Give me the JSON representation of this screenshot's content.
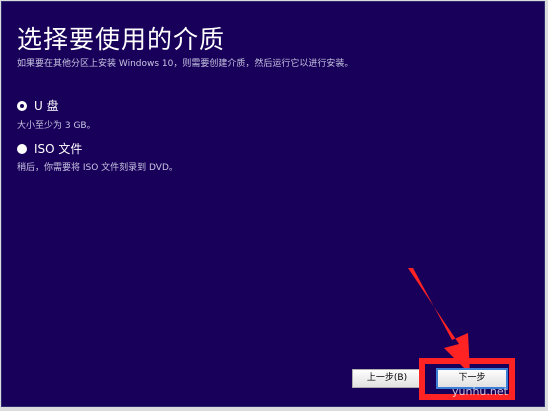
{
  "page": {
    "title": "选择要使用的介质",
    "subtitle": "如果要在其他分区上安装 Windows 10，则需要创建介质，然后运行它以进行安装。"
  },
  "options": [
    {
      "label": "U 盘",
      "description": "大小至少为 3 GB。",
      "selected": true
    },
    {
      "label": "ISO 文件",
      "description": "稍后，你需要将 ISO 文件刻录到 DVD。",
      "selected": false
    }
  ],
  "buttons": {
    "back": "上一步(B)",
    "next": "下一步"
  },
  "watermark": "yunhu.net",
  "colors": {
    "background": "#18005a",
    "highlight": "#ff2323",
    "focus_border": "#3c7fd6"
  }
}
